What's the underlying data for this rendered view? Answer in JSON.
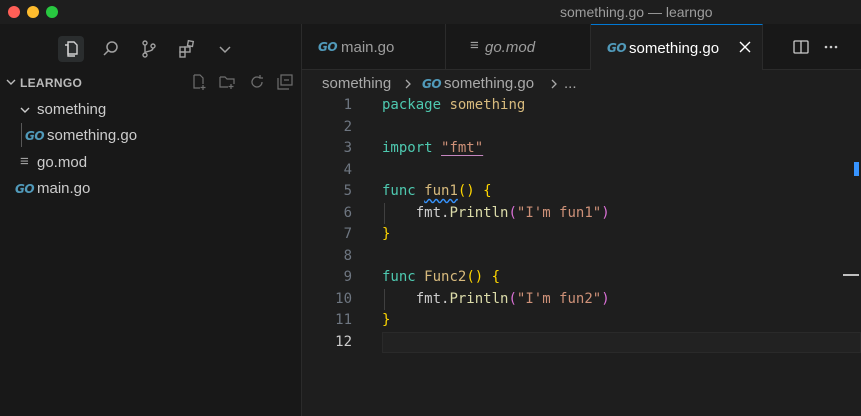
{
  "window": {
    "title": "something.go — learngo"
  },
  "activity_bar": {
    "icons": [
      "explorer-icon",
      "search-icon",
      "source-control-icon",
      "extensions-icon",
      "chevron-down-icon"
    ]
  },
  "explorer": {
    "title": "LEARNGO",
    "actions": [
      "new-file-icon",
      "new-folder-icon",
      "refresh-icon",
      "collapse-all-icon"
    ],
    "tree": [
      {
        "label": "something",
        "type": "folder",
        "depth": 1
      },
      {
        "label": "something.go",
        "type": "go",
        "depth": 2
      },
      {
        "label": "go.mod",
        "type": "gomod",
        "depth": 1
      },
      {
        "label": "main.go",
        "type": "go",
        "depth": 1
      }
    ]
  },
  "tabs": [
    {
      "label": "main.go",
      "icon": "go-icon",
      "active": false
    },
    {
      "label": "go.mod",
      "icon": "gomod-icon",
      "active": false
    },
    {
      "label": "something.go",
      "icon": "go-icon",
      "active": true
    }
  ],
  "breadcrumb": {
    "folder": "something",
    "file": "something.go",
    "more": "..."
  },
  "editor": {
    "line_numbers": [
      "1",
      "2",
      "3",
      "4",
      "5",
      "6",
      "7",
      "8",
      "9",
      "10",
      "11",
      "12"
    ],
    "current_line": 12,
    "lines": {
      "l1_kw": "package",
      "l1_name": "something",
      "l3_kw": "import",
      "l3_str": "\"fmt\"",
      "l5_kw": "func",
      "l5_fn": "fun1",
      "l6_pkg": "fmt",
      "l6_method": "Println",
      "l6_str": "\"I'm fun1\"",
      "l9_kw": "func",
      "l9_fn": "Func2",
      "l10_pkg": "fmt",
      "l10_method": "Println",
      "l10_str": "\"I'm fun2\""
    }
  },
  "colors": {
    "accent": "#0078d4",
    "go_icon": "#519aba",
    "keyword": "#4ec9b0",
    "string": "#ce9178",
    "function": "#dcdcaa"
  }
}
